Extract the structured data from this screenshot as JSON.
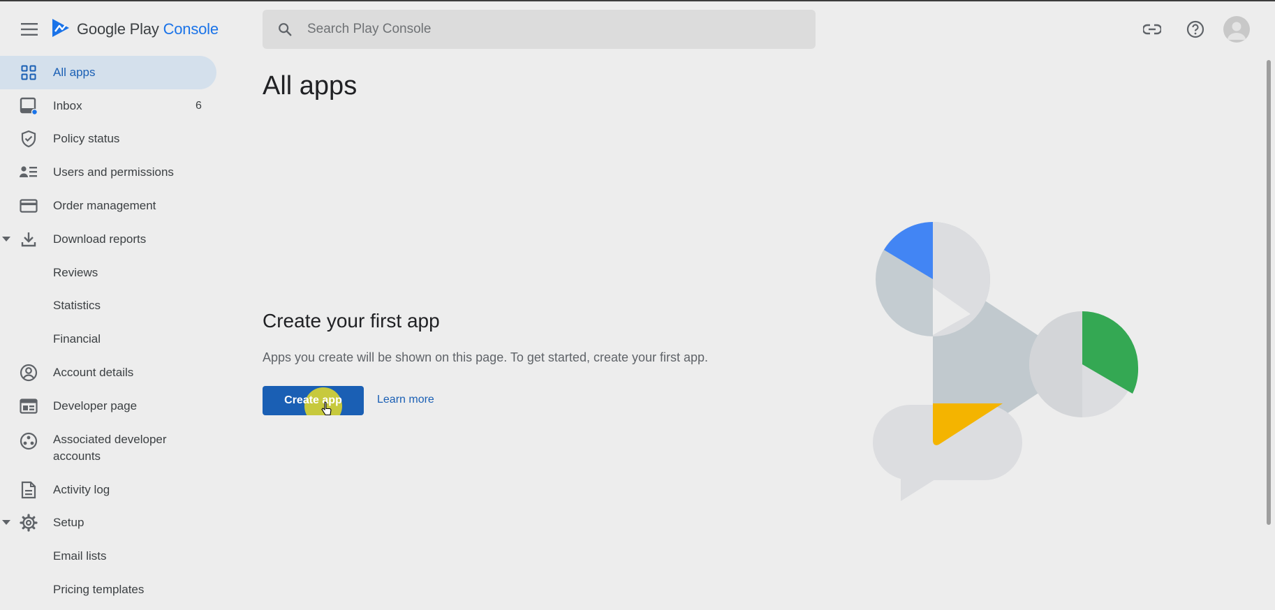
{
  "app": {
    "brand_main": "Google Play",
    "brand_accent": "Console"
  },
  "search": {
    "placeholder": "Search Play Console"
  },
  "header_icons": [
    "link-icon",
    "help-icon",
    "avatar"
  ],
  "sidebar": {
    "items": [
      {
        "label": "All apps",
        "icon": "grid-icon",
        "active": true
      },
      {
        "label": "Inbox",
        "icon": "inbox-icon",
        "count": "6"
      },
      {
        "label": "Policy status",
        "icon": "shield-check-icon"
      },
      {
        "label": "Users and permissions",
        "icon": "users-icon"
      },
      {
        "label": "Order management",
        "icon": "credit-card-icon"
      },
      {
        "label": "Download reports",
        "icon": "download-icon",
        "expanded": true
      },
      {
        "label": "Reviews",
        "sub": true
      },
      {
        "label": "Statistics",
        "sub": true
      },
      {
        "label": "Financial",
        "sub": true
      },
      {
        "label": "Account details",
        "icon": "account-circle-icon"
      },
      {
        "label": "Developer page",
        "icon": "web-page-icon"
      },
      {
        "label": "Associated developer accounts",
        "icon": "linked-accounts-icon"
      },
      {
        "label": "Activity log",
        "icon": "document-icon"
      },
      {
        "label": "Setup",
        "icon": "gear-icon",
        "expanded": true
      },
      {
        "label": "Email lists",
        "sub": true
      },
      {
        "label": "Pricing templates",
        "sub": true
      }
    ]
  },
  "main": {
    "title": "All apps",
    "empty_title": "Create your first app",
    "empty_description": "Apps you create will be shown on this page. To get started, create your first app.",
    "create_button": "Create app",
    "learn_more": "Learn more"
  },
  "colors": {
    "accent_blue": "#1a5fb4",
    "active_bg": "#d4e0ec",
    "illustration_blue": "#4285f4",
    "illustration_green": "#34a853",
    "illustration_yellow": "#f4b400"
  }
}
